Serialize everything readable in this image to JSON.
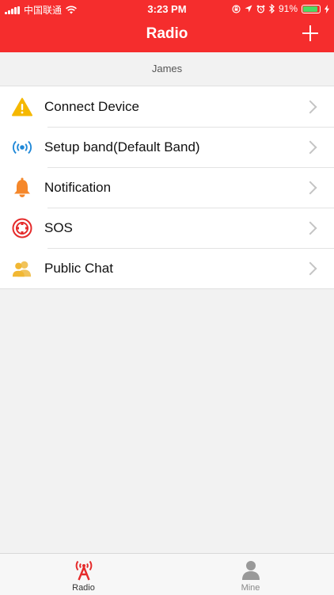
{
  "status_bar": {
    "carrier": "中国联通",
    "time": "3:23 PM",
    "battery": "91%",
    "battery_level": 0.91
  },
  "nav": {
    "title": "Radio"
  },
  "user": {
    "name": "James"
  },
  "menu": {
    "items": [
      {
        "label": "Connect Device",
        "icon": "warning-icon",
        "icon_color": "#f5b800"
      },
      {
        "label": "Setup band(Default Band)",
        "icon": "broadcast-icon",
        "icon_color": "#1f88d8"
      },
      {
        "label": "Notification",
        "icon": "bell-icon",
        "icon_color": "#f5872a"
      },
      {
        "label": "SOS",
        "icon": "sos-icon",
        "icon_color": "#e52b2b"
      },
      {
        "label": "Public Chat",
        "icon": "group-chat-icon",
        "icon_color": "#f1b733"
      }
    ]
  },
  "tabs": [
    {
      "label": "Radio",
      "icon": "radio-tower-icon",
      "active": true
    },
    {
      "label": "Mine",
      "icon": "person-icon",
      "active": false
    }
  ],
  "colors": {
    "brand_red": "#f52d2d",
    "background": "#f2f2f2"
  }
}
